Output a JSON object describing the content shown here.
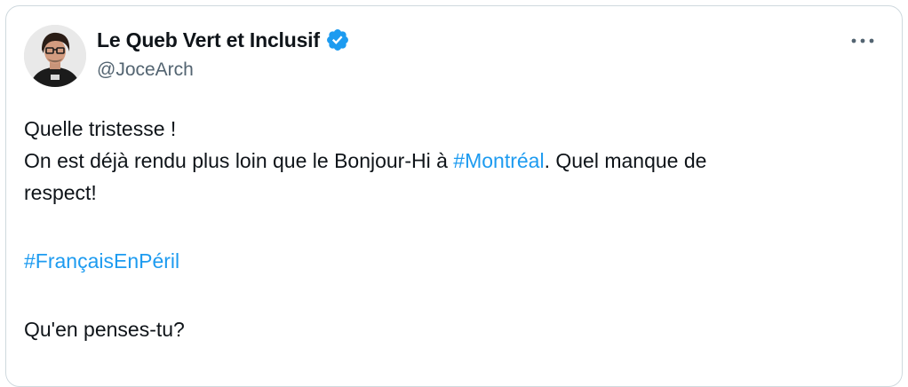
{
  "author": {
    "display_name": "Le Queb Vert et Inclusif",
    "handle": "@JoceArch",
    "verified": true,
    "avatar_icon": "user-avatar-photo",
    "verified_color": "#1d9bf0"
  },
  "menu": {
    "icon": "more-dots-icon"
  },
  "tweet": {
    "line1": "Quelle tristesse !",
    "line2_before": "On est déjà rendu plus loin que le Bonjour-Hi à ",
    "hashtag_montreal": "#Montréal",
    "line2_after": ". Quel manque de",
    "line3": "respect!",
    "hashtag_francais": "#FrançaisEnPéril",
    "question": "Qu'en penses-tu?"
  },
  "colors": {
    "text": "#0f1419",
    "secondary_text": "#536471",
    "link": "#1d9bf0",
    "border": "#cfd9de"
  }
}
